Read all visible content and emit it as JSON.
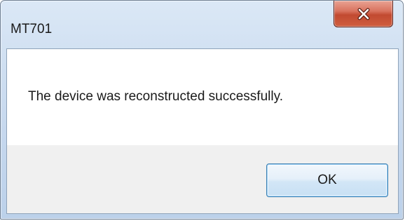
{
  "window": {
    "title": "MT701"
  },
  "titlebar": {
    "close_icon": "close-icon"
  },
  "dialog": {
    "message": "The device was reconstructed successfully.",
    "ok_label": "OK"
  },
  "colors": {
    "close_button": "#c9553c",
    "ok_border": "#3c7fb1",
    "frame": "#c6d8ee",
    "button_area": "#f0f0f0"
  }
}
